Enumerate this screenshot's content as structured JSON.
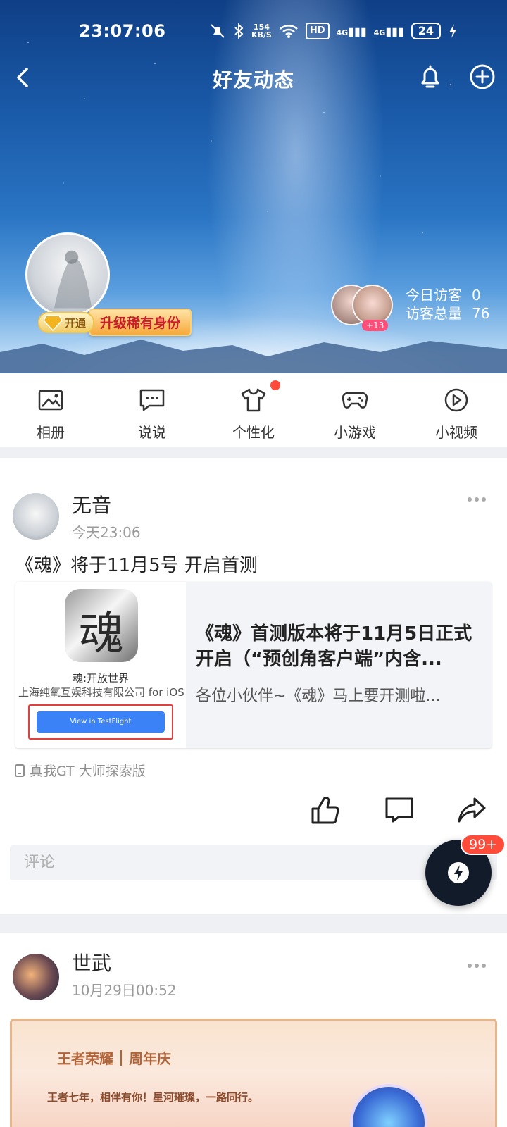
{
  "status_bar": {
    "time": "23:07:06",
    "speed": "154",
    "speed_unit": "KB/S",
    "hd": "HD",
    "net1": "4G",
    "net2": "4G",
    "battery": "24"
  },
  "header": {
    "title": "好友动态"
  },
  "profile": {
    "vip_open": "开通",
    "upgrade": "升级稀有身份",
    "visitor_more": "+13"
  },
  "visitors": {
    "today_label": "今日访客",
    "today_value": "0",
    "total_label": "访客总量",
    "total_value": "76"
  },
  "quicknav": {
    "items": [
      {
        "label": "相册",
        "icon": "photo-icon"
      },
      {
        "label": "说说",
        "icon": "chat-bubble-icon"
      },
      {
        "label": "个性化",
        "icon": "tshirt-icon"
      },
      {
        "label": "小游戏",
        "icon": "gamepad-icon"
      },
      {
        "label": "小视频",
        "icon": "play-icon"
      }
    ]
  },
  "posts": [
    {
      "author": "无音",
      "time": "今天23:06",
      "text": "《魂》将于11月5号 开启首测",
      "share": {
        "app_icon_char": "魂",
        "app_name": "魂:开放世界",
        "company": "上海纯氧互娱科技有限公司 for iOS",
        "button": "View in TestFlight",
        "title": "《魂》首测版本将于11月5日正式开启（“预创角客户端”内含...",
        "desc": "各位小伙伴~《魂》马上要开测啦..."
      },
      "device": "真我GT 大师探索版",
      "comment_placeholder": "评论"
    },
    {
      "author": "世武",
      "time": "10月29日00:52",
      "image": {
        "brand": "王者荣耀",
        "event": "周年庆",
        "slogan": "王者七年，相伴有你！星河璀璨，一路同行。"
      }
    }
  ],
  "fab": {
    "badge": "99+"
  }
}
